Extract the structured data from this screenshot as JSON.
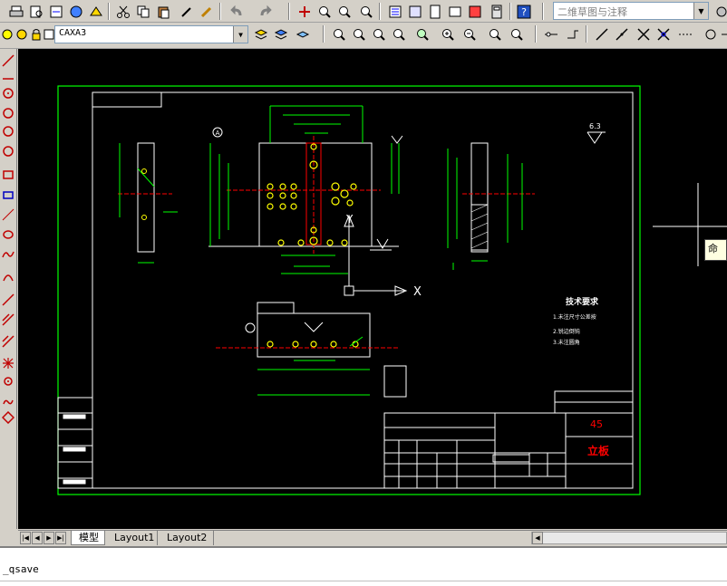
{
  "toolbar": {
    "workspace_combo": "二维草图与注释",
    "layer_combo": "CAXA3"
  },
  "tabs": [
    {
      "label": "模型"
    },
    {
      "label": "Layout1"
    },
    {
      "label": "Layout2"
    }
  ],
  "command_line": {
    "last_command": "_qsave"
  },
  "popup": {
    "label": "命"
  },
  "drawing": {
    "tech_title": "技术要求",
    "tech_items": [
      "1.未注尺寸公差按",
      "2.锐边倒钝",
      "3.未注圆角"
    ],
    "material": "45",
    "part_name": "立板",
    "axis_x": "X",
    "axis_y": "Y",
    "surface_mark": "6.3",
    "datum_label": "A"
  },
  "colors": {
    "canvas_bg": "#000000",
    "frame": "#00ff00",
    "border": "#ffffff",
    "hole": "#ffff00",
    "center": "#ff0000",
    "text_red": "#ff0000"
  }
}
